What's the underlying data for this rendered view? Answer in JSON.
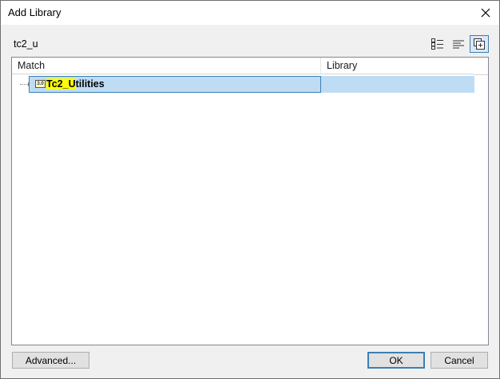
{
  "window": {
    "title": "Add Library",
    "close_icon": "close-icon"
  },
  "search": {
    "value": "tc2_u"
  },
  "view_toolbar": {
    "buttons": [
      {
        "icon": "category-view-icon",
        "active": false
      },
      {
        "icon": "list-view-icon",
        "active": false
      },
      {
        "icon": "show-all-versions-icon",
        "active": true
      }
    ]
  },
  "results": {
    "columns": {
      "match": "Match",
      "library": "Library"
    },
    "rows": [
      {
        "icon": "library-icon",
        "icon_text": "3.0",
        "name_highlight": "Tc2_U",
        "name_rest": "tilities",
        "library": "",
        "selected": true
      }
    ]
  },
  "buttons": {
    "advanced": "Advanced...",
    "ok": "OK",
    "cancel": "Cancel"
  },
  "colors": {
    "selection": "#bfdcf5",
    "selection_border": "#3c7fb1",
    "search_highlight": "#ffff00"
  }
}
